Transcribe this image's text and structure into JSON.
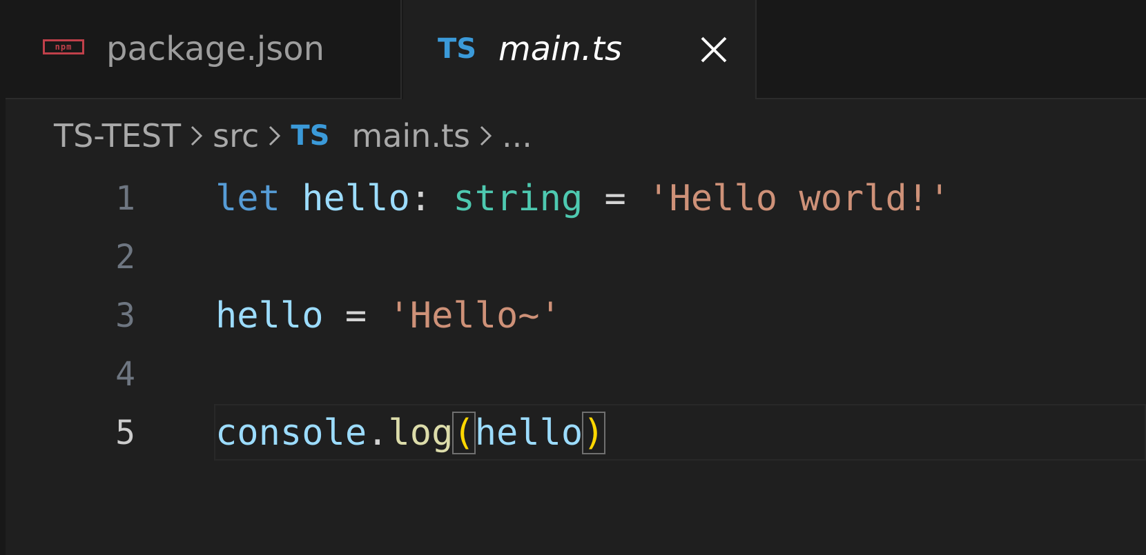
{
  "tabs": [
    {
      "icon": "npm-icon",
      "icon_text": "npm",
      "label": "package.json",
      "active": false
    },
    {
      "icon": "ts-icon",
      "icon_text": "TS",
      "label": "main.ts",
      "active": true
    }
  ],
  "breadcrumb": {
    "root": "TS-TEST",
    "folder": "src",
    "file_icon_text": "TS",
    "file": "main.ts",
    "trail": "..."
  },
  "editor": {
    "current_line": 5,
    "lines": [
      {
        "number": "1",
        "tokens": [
          {
            "text": "let",
            "kind": "kw"
          },
          {
            "text": " ",
            "kind": "op"
          },
          {
            "text": "hello",
            "kind": "var"
          },
          {
            "text": ": ",
            "kind": "op"
          },
          {
            "text": "string",
            "kind": "type"
          },
          {
            "text": " = ",
            "kind": "op"
          },
          {
            "text": "'Hello world!'",
            "kind": "str"
          }
        ]
      },
      {
        "number": "2",
        "tokens": []
      },
      {
        "number": "3",
        "tokens": [
          {
            "text": "hello",
            "kind": "var"
          },
          {
            "text": " = ",
            "kind": "op"
          },
          {
            "text": "'Hello~'",
            "kind": "str"
          }
        ]
      },
      {
        "number": "4",
        "tokens": []
      },
      {
        "number": "5",
        "tokens": [
          {
            "text": "console",
            "kind": "var"
          },
          {
            "text": ".",
            "kind": "op"
          },
          {
            "text": "log",
            "kind": "fn"
          },
          {
            "text": "(",
            "kind": "brace"
          },
          {
            "text": "hello",
            "kind": "var"
          },
          {
            "text": ")",
            "kind": "brace"
          }
        ]
      }
    ]
  },
  "colors": {
    "background": "#1f1f1f",
    "tabbar": "#181818",
    "keyword": "#569cd6",
    "variable": "#9cdcfe",
    "type": "#4ec9b0",
    "string": "#ce9178",
    "function": "#dcdcaa",
    "bracket": "#ffd700",
    "ts_icon": "#3b9ad9",
    "npm_icon": "#c0404a"
  }
}
